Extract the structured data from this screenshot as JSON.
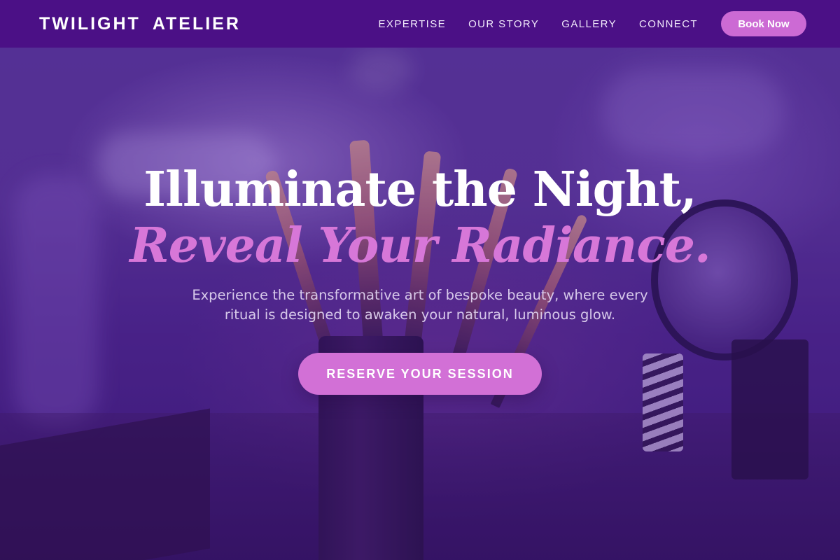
{
  "header": {
    "brand": "TWILIGHT  ATELIER",
    "nav": [
      {
        "label": "EXPERTISE"
      },
      {
        "label": "OUR STORY"
      },
      {
        "label": "GALLERY"
      },
      {
        "label": "CONNECT"
      }
    ],
    "book_label": "Book Now"
  },
  "hero": {
    "headline_line1": "Illuminate the Night,",
    "headline_line2": "Reveal Your Radiance.",
    "subtext": "Experience the transformative art of bespoke beauty, where every ritual is designed to awaken your natural, luminous glow.",
    "cta_label": "RESERVE YOUR SESSION"
  },
  "colors": {
    "header_bg": "#4b1086",
    "accent": "#d270d6",
    "headline": "#ffffff",
    "headline_italic": "#d777d8",
    "hero_overlay": "#5a3896"
  }
}
